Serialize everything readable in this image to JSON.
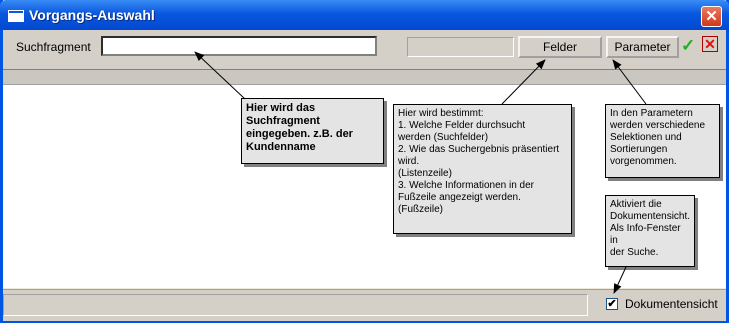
{
  "window": {
    "title": "Vorgangs-Auswahl",
    "close_glyph": "✕"
  },
  "toolbar": {
    "search_label": "Suchfragment",
    "search_value": "",
    "felder_label": "Felder",
    "parameter_label": "Parameter",
    "ok_glyph": "✓",
    "cancel_glyph": "✕"
  },
  "footer": {
    "checkbox_label": "Dokumentensicht",
    "checkbox_checked": true,
    "check_glyph": "✔"
  },
  "annotations": [
    {
      "text": "Hier wird das\nSuchfragment\neingegeben. z.B. der\nKundenname"
    },
    {
      "text": "Hier wird bestimmt:\n1. Welche Felder durchsucht\nwerden (Suchfelder)\n2. Wie das Suchergebnis präsentiert\nwird.\n(Listenzeile)\n3. Welche Informationen in der\nFußzeile angezeigt werden.\n(Fußzeile)"
    },
    {
      "text": "In den Parametern\nwerden verschiedene\nSelektionen und\nSortierungen\nvorgenommen."
    },
    {
      "text": "Aktiviert die\nDokumentensicht.\nAls Info-Fenster in\nder Suche."
    }
  ],
  "colors": {
    "titlebar": "#0a58e0",
    "dialog_bg": "#d4d0c8",
    "ok_icon": "#20b020",
    "cancel_icon": "#e01010",
    "note_bg": "#e4e4e4"
  }
}
